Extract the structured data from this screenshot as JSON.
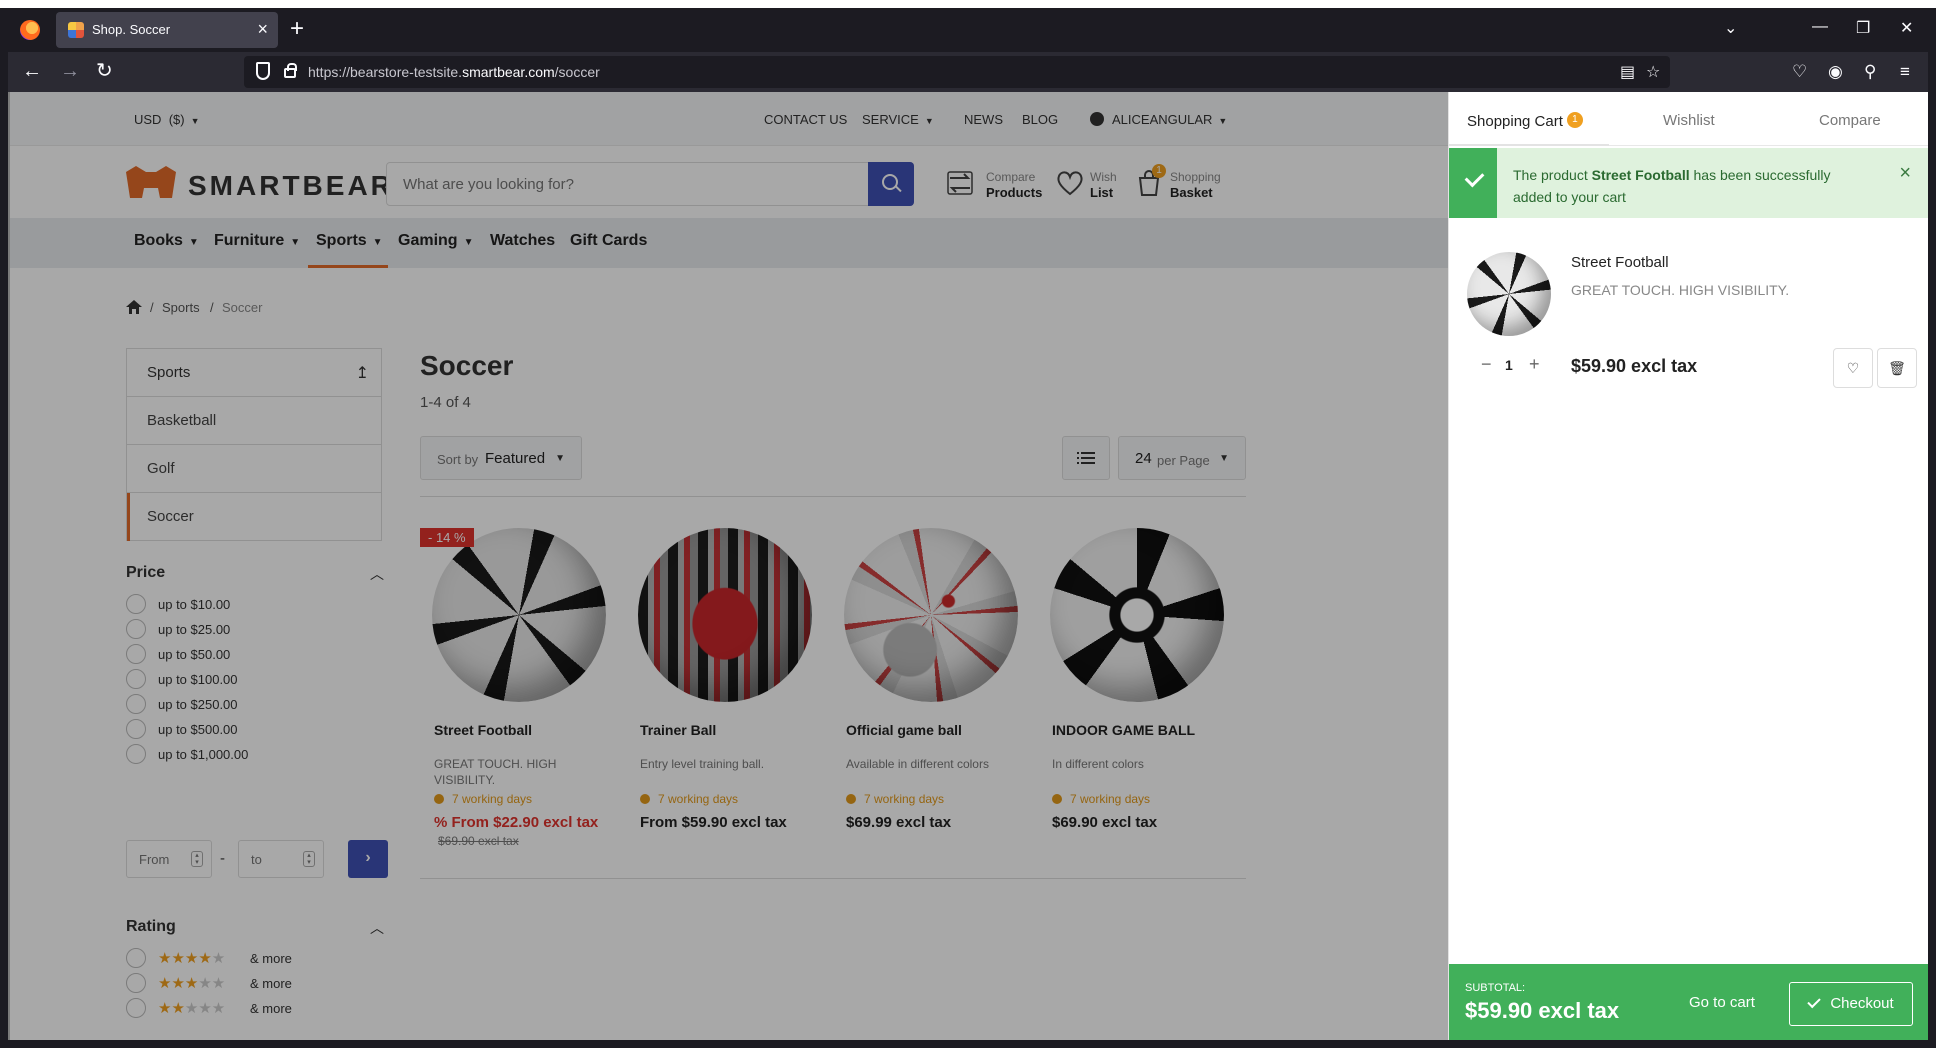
{
  "browser": {
    "tab_title": "Shop. Soccer",
    "url_prefix": "https://bearstore-testsite.",
    "url_domain": "smartbear.com",
    "url_path": "/soccer"
  },
  "utility": {
    "currency": "USD",
    "currency_symbol": "($)",
    "contact": "CONTACT US",
    "service": "SERVICE",
    "news": "NEWS",
    "blog": "BLOG",
    "account": "ALICEANGULAR"
  },
  "header": {
    "logo_text": "SMARTBEAR",
    "search_placeholder": "What are you looking for?",
    "compare_l1": "Compare",
    "compare_l2": "Products",
    "wish_l1": "Wish",
    "wish_l2": "List",
    "basket_l1": "Shopping",
    "basket_l2": "Basket",
    "basket_count": "1"
  },
  "categories": [
    "Books",
    "Furniture",
    "Sports",
    "Gaming",
    "Watches",
    "Gift Cards"
  ],
  "breadcrumb": {
    "sports": "Sports",
    "soccer": "Soccer"
  },
  "sidebar": {
    "head": "Sports",
    "items": [
      "Basketball",
      "Golf",
      "Soccer"
    ]
  },
  "price_facet": {
    "title": "Price",
    "options": [
      "up to $10.00",
      "up to $25.00",
      "up to $50.00",
      "up to $100.00",
      "up to $250.00",
      "up to $500.00",
      "up to $1,000.00"
    ],
    "from_placeholder": "From",
    "to_placeholder": "to",
    "dash": "-"
  },
  "rating_facet": {
    "title": "Rating",
    "options": [
      {
        "stars": 4,
        "label": "& more"
      },
      {
        "stars": 3,
        "label": "& more"
      },
      {
        "stars": 2,
        "label": "& more"
      }
    ]
  },
  "listing": {
    "title": "Soccer",
    "count": "1-4 of 4",
    "sort_key": "Sort by",
    "sort_value": "Featured",
    "per_page_value": "24",
    "per_page_key": "per Page"
  },
  "products": [
    {
      "name": "Street Football",
      "desc": "GREAT TOUCH. HIGH VISIBILITY.",
      "delivery": "7 working days",
      "price": "% From $22.90 excl tax",
      "old_price": "$69.90 excl tax",
      "badge": "- 14 %"
    },
    {
      "name": "Trainer Ball",
      "desc": "Entry level training ball.",
      "delivery": "7 working days",
      "price": "From $59.90 excl tax"
    },
    {
      "name": "Official game ball",
      "desc": "Available in different colors",
      "delivery": "7 working days",
      "price": "$69.99 excl tax"
    },
    {
      "name": "INDOOR GAME BALL",
      "desc": "In different colors",
      "delivery": "7 working days",
      "price": "$69.90 excl tax"
    }
  ],
  "panel": {
    "tab_cart": "Shopping Cart",
    "tab_cart_count": "1",
    "tab_wishlist": "Wishlist",
    "tab_compare": "Compare",
    "notice_pre": "The product ",
    "notice_product": "Street Football",
    "notice_post": " has been successfully added to your cart",
    "item_name": "Street Football",
    "item_desc": "GREAT TOUCH. HIGH VISIBILITY.",
    "item_qty": "1",
    "item_price": "$59.90 excl tax",
    "subtotal_label": "SUBTOTAL:",
    "subtotal_value": "$59.90 excl tax",
    "go_to_cart": "Go to cart",
    "checkout": "Checkout"
  },
  "colors": {
    "accent_blue": "#3f51b5",
    "accent_orange": "#e36b2a",
    "success_green": "#41b05a",
    "discount_red": "#e0322d",
    "badge_yellow": "#f0a020"
  }
}
